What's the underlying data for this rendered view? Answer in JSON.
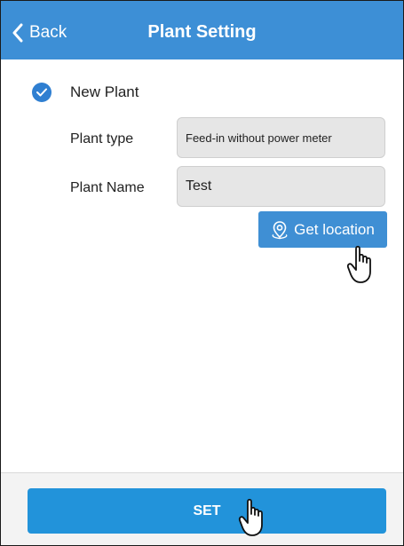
{
  "navbar": {
    "back_label": "Back",
    "title": "Plant Setting"
  },
  "form": {
    "new_plant_label": "New Plant",
    "new_plant_checked": true,
    "plant_type_label": "Plant type",
    "plant_type_value": "Feed-in without power meter",
    "plant_name_label": "Plant Name",
    "plant_name_value": "Test",
    "get_location_label": "Get location"
  },
  "footer": {
    "set_label": "SET"
  },
  "icons": {
    "back": "chevron-left-icon",
    "check": "check-circle-icon",
    "location": "location-pin-icon",
    "pointer": "hand-pointer-icon"
  },
  "colors": {
    "navbar": "#3d8fd6",
    "checkbox": "#2f7fd1",
    "location_button": "#3f8fd4",
    "set_button": "#2293da",
    "field_bg": "#e6e6e6"
  }
}
